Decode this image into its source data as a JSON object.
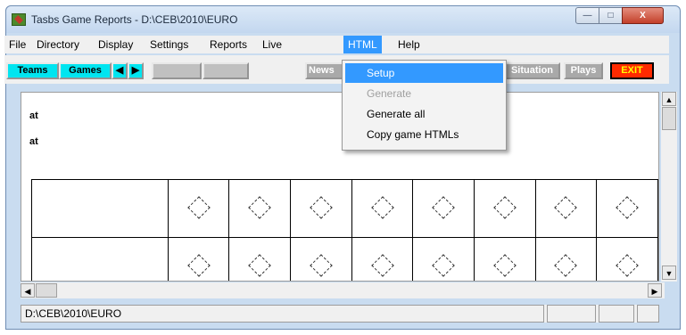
{
  "window": {
    "title": "Tasbs Game Reports - D:\\CEB\\2010\\EURO",
    "min_glyph": "—",
    "max_glyph": "□",
    "close_glyph": "X"
  },
  "menubar": {
    "items": [
      "File",
      "Directory",
      "Display",
      "Settings",
      "Reports",
      "Live",
      "HTML",
      "Help"
    ],
    "active": "HTML"
  },
  "toolbar": {
    "teams": "Teams",
    "games": "Games",
    "prev_icon": "◀",
    "next_icon": "▶",
    "news": "News",
    "situation": "Situation",
    "plays": "Plays",
    "exit": "EXIT"
  },
  "html_menu": {
    "setup": "Setup",
    "generate": "Generate",
    "generate_all": "Generate all",
    "copy": "Copy game HTMLs"
  },
  "content": {
    "line1": "at",
    "line2": "at"
  },
  "scroll": {
    "up": "▲",
    "down": "▼",
    "left": "◀",
    "right": "▶"
  },
  "status": {
    "path": "D:\\CEB\\2010\\EURO"
  }
}
